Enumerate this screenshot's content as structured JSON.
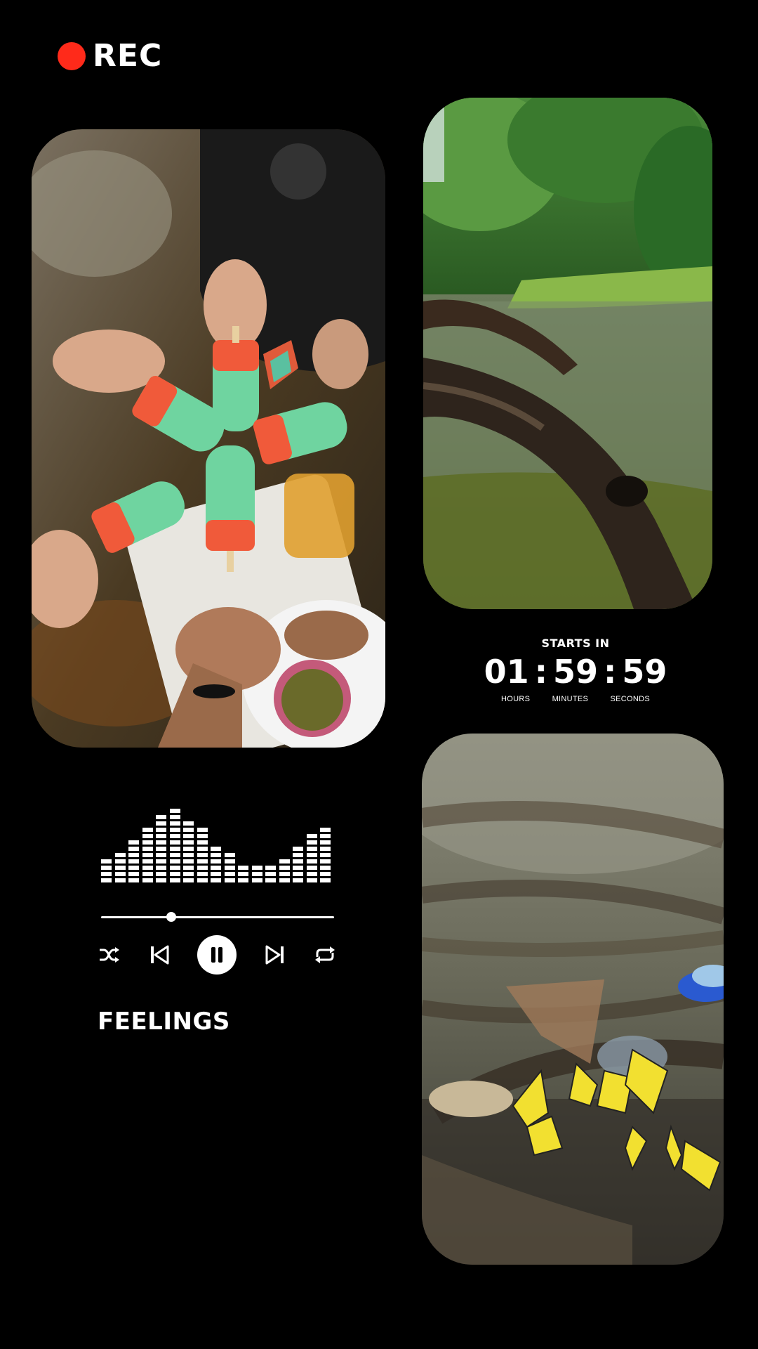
{
  "recording": {
    "label": "REC",
    "dot_color": "#ff2a1a"
  },
  "photos": [
    {
      "id": "popsicles",
      "subject": "hands holding watermelon popsicles over a stream"
    },
    {
      "id": "river",
      "subject": "tree root in a jungle river"
    },
    {
      "id": "butterflies",
      "subject": "yellow butterflies on forest ground"
    }
  ],
  "countdown": {
    "title": "STARTS IN",
    "hours": "01",
    "minutes": "59",
    "seconds": "59",
    "separator": ":",
    "labels": {
      "hours": "HOURS",
      "minutes": "MINUTES",
      "seconds": "SECONDS"
    }
  },
  "player": {
    "track_title": "FEELINGS",
    "progress_fraction": 0.3,
    "equalizer_levels": [
      4,
      5,
      7,
      9,
      11,
      12,
      10,
      9,
      6,
      5,
      3,
      3,
      3,
      4,
      6,
      8,
      9
    ],
    "controls": {
      "shuffle": "shuffle-icon",
      "previous": "skip-previous-icon",
      "play_pause": "pause-icon",
      "next": "skip-next-icon",
      "repeat": "repeat-icon"
    }
  }
}
